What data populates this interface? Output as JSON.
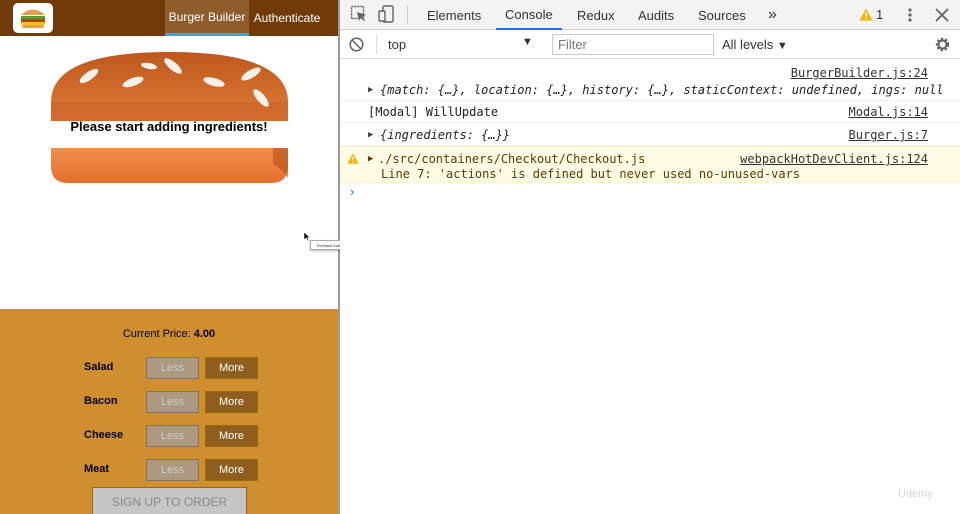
{
  "app": {
    "nav": {
      "burger_builder": "Burger Builder",
      "authenticate": "Authenticate"
    },
    "burger_message": "Please start adding ingredients!",
    "price": {
      "label": "Current Price:",
      "value": "4.00"
    },
    "controls": [
      {
        "label": "Salad",
        "less": "Less",
        "more": "More"
      },
      {
        "label": "Bacon",
        "less": "Less",
        "more": "More"
      },
      {
        "label": "Cheese",
        "less": "Less",
        "more": "More"
      },
      {
        "label": "Meat",
        "less": "Less",
        "more": "More"
      }
    ],
    "order_button": "SIGN UP TO ORDER",
    "tooltip": "Firebase Auth REST API | Firebase"
  },
  "devtools": {
    "tabs": [
      "Elements",
      "Console",
      "Redux",
      "Audits",
      "Sources"
    ],
    "more_tabs": "»",
    "warning_count": "1",
    "context": "top",
    "filter_placeholder": "Filter",
    "levels": "All levels",
    "logs": [
      {
        "source": "BurgerBuilder.js:24",
        "text": "{match: {…}, location: {…}, history: {…}, staticContext: undefined, ings: null"
      },
      {
        "source": "Modal.js:14",
        "text": "[Modal] WillUpdate"
      },
      {
        "source": "Burger.js:7",
        "text": "{ingredients: {…}}"
      },
      {
        "source": "webpackHotDevClient.js:124",
        "text": "./src/containers/Checkout/Checkout.js",
        "detail": "Line 7:  'actions' is defined but never used  no-unused-vars"
      }
    ],
    "prompt": "›"
  },
  "watermark": "Udemy",
  "colors": {
    "toolbar": "#703b09",
    "controls_bg": "#cf8f2e",
    "more_btn": "#8f5e1e",
    "active_tab": "#1a73e8"
  }
}
